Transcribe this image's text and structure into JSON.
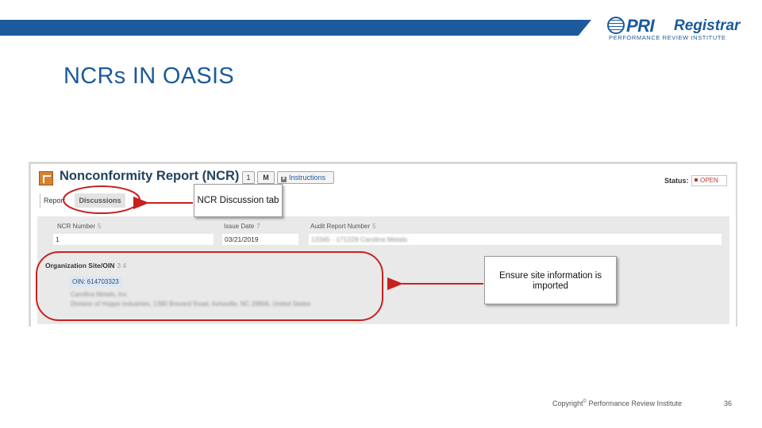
{
  "header": {
    "logo_pri": "PRI",
    "logo_registrar": "Registrar",
    "logo_tagline": "PERFORMANCE REVIEW INSTITUTE",
    "brand_color": "#1c5a9b"
  },
  "slide_title": "NCRs IN OASIS",
  "screenshot": {
    "ncr_title": "Nonconformity Report (NCR)",
    "count_chip": "1",
    "mail_chip": "M",
    "instructions_label": "Instructions",
    "status_label": "Status:",
    "status_value": "OPEN",
    "tabs": [
      "Report",
      "Discussions"
    ],
    "fields": {
      "ncr_number_label": "NCR Number",
      "ncr_number_hint": "5",
      "ncr_number_value": "1",
      "issue_date_label": "Issue Date",
      "issue_date_hint": "7",
      "issue_date_value": "03/21/2019",
      "audit_report_label": "Audit Report Number",
      "audit_report_hint": "5",
      "audit_report_value": "13345 - 171229 Carolina Metals"
    },
    "org": {
      "label": "Organization Site/OIN",
      "hint": "3 4",
      "oin": "OIN: 614703323",
      "line1": "Carolina Metals, Inc.",
      "line2": "Division of Hoppe Industries, 1390 Brevard Road, Asheville, NC 28806, United States"
    }
  },
  "callouts": {
    "tab_note": "NCR Discussion tab",
    "site_note": "Ensure site information is imported"
  },
  "footer": {
    "copyright": "Copyright",
    "copyright_symbol": "©",
    "org": " Performance Review Institute",
    "page_number": "36"
  },
  "colors": {
    "annotation_red": "#c8211f",
    "status_red": "#c0392b"
  }
}
